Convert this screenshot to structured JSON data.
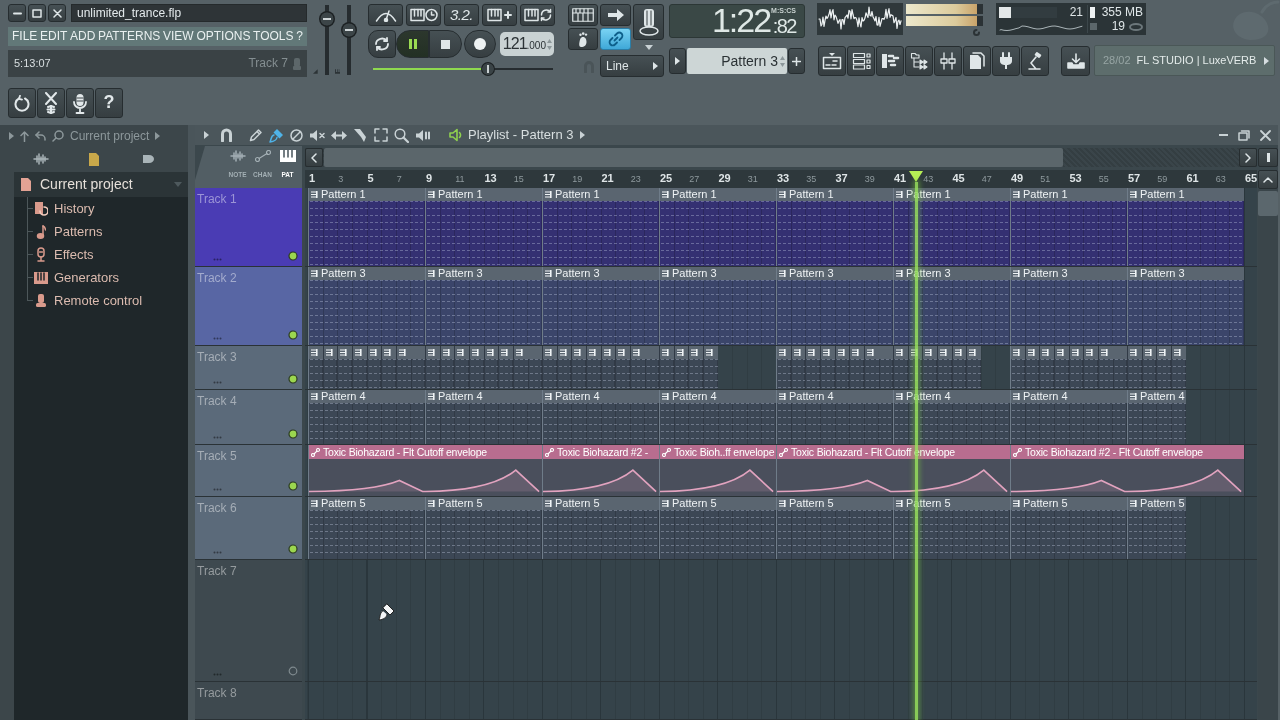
{
  "title_field": "unlimited_trance.flp",
  "menu": [
    "FILE",
    "EDIT",
    "ADD",
    "PATTERNS",
    "VIEW",
    "OPTIONS",
    "TOOLS",
    "?"
  ],
  "hint_bar": {
    "time": "5:13:07",
    "target": "Track 7"
  },
  "master": {
    "volume": {
      "level": 0.88
    },
    "pitch": {
      "level": 0.68
    }
  },
  "transport": {
    "countdown_label": "3.2.",
    "playing": true,
    "tempo": "121",
    "tempo_fraction": ".000",
    "song_position": {
      "level": 0.65
    }
  },
  "snap": {
    "link_on": true,
    "mode": "Line"
  },
  "time_display": {
    "main": "1:22",
    "centiseconds": ":82",
    "format": "M:S:CS"
  },
  "pattern_selector": {
    "value": "Pattern 3"
  },
  "peak_meter": [
    {
      "level": 0.92
    },
    {
      "level": 0.92
    }
  ],
  "cpu_panel": {
    "cpu": {
      "level": 0.2,
      "value": "21"
    },
    "memory": "355 MB",
    "polyphony": "19"
  },
  "hint_panel": {
    "date": "28/02",
    "text": "FL STUDIO | LuxeVERB"
  },
  "quick_buttons": {
    "help": "?"
  },
  "browser": {
    "path": "Current project",
    "tree": [
      {
        "label": "Current project",
        "kind": "project",
        "expanded": true,
        "children": [
          {
            "label": "History",
            "kind": "history"
          },
          {
            "label": "Patterns",
            "kind": "patterns"
          },
          {
            "label": "Effects",
            "kind": "effects"
          },
          {
            "label": "Generators",
            "kind": "generators"
          },
          {
            "label": "Remote control",
            "kind": "remote"
          }
        ]
      }
    ]
  },
  "playlist": {
    "title": "Playlist - Pattern 3",
    "tools": [
      {
        "kind": "pencil",
        "selected": false
      },
      {
        "kind": "brush",
        "selected": true
      },
      {
        "kind": "delete",
        "selected": false
      },
      {
        "kind": "mute",
        "selected": false
      },
      {
        "kind": "slip",
        "selected": false
      },
      {
        "kind": "slice",
        "selected": false
      },
      {
        "kind": "select",
        "selected": false
      },
      {
        "kind": "zoom",
        "selected": false
      },
      {
        "kind": "playback",
        "selected": false
      }
    ],
    "header_tabs": [
      {
        "label": "NOTE",
        "kind": "note",
        "selected": false
      },
      {
        "label": "CHAN",
        "kind": "chan",
        "selected": false
      },
      {
        "label": "PAT",
        "kind": "pat",
        "selected": true
      }
    ],
    "ruler": [
      "1",
      "3",
      "5",
      "7",
      "9",
      "11",
      "13",
      "15",
      "17",
      "19",
      "21",
      "23",
      "25",
      "27",
      "29",
      "31",
      "33",
      "35",
      "37",
      "39",
      "41",
      "43",
      "45",
      "47",
      "49",
      "51",
      "53",
      "55",
      "57",
      "59",
      "61",
      "63",
      "65"
    ],
    "playhead": {
      "level": 0.65
    },
    "tracks": [
      {
        "name": "Track 1",
        "color": "#4a3cb4",
        "active": true,
        "clips": [
          {
            "kind": "pattern",
            "label": "Pattern 1"
          },
          {
            "kind": "pattern",
            "label": "Pattern 1"
          },
          {
            "kind": "pattern",
            "label": "Pattern 1"
          },
          {
            "kind": "pattern",
            "label": "Pattern 1"
          },
          {
            "kind": "pattern",
            "label": "Pattern 1"
          },
          {
            "kind": "pattern",
            "label": "Pattern 1"
          },
          {
            "kind": "pattern",
            "label": "Pattern 1"
          },
          {
            "kind": "pattern",
            "label": "Pattern 1"
          }
        ]
      },
      {
        "name": "Track 2",
        "color": "#5866a4",
        "active": true,
        "clips": [
          {
            "kind": "pattern",
            "label": "Pattern 3"
          },
          {
            "kind": "pattern",
            "label": "Pattern 3"
          },
          {
            "kind": "pattern",
            "label": "Pattern 3"
          },
          {
            "kind": "pattern",
            "label": "Pattern 3"
          },
          {
            "kind": "pattern",
            "label": "Pattern 3"
          },
          {
            "kind": "pattern",
            "label": "Pattern 3"
          },
          {
            "kind": "pattern",
            "label": "Pattern 3"
          },
          {
            "kind": "pattern",
            "label": "Pattern 3"
          }
        ]
      },
      {
        "name": "Track 3",
        "color": "#5b6a7a",
        "active": true,
        "clips": [
          {
            "kind": "pattern"
          },
          {
            "kind": "pattern"
          },
          {
            "kind": "pattern"
          },
          {
            "kind": "pattern"
          },
          {
            "kind": "pattern"
          },
          {
            "kind": "pattern"
          },
          {
            "kind": "pattern"
          },
          {
            "kind": "pattern"
          },
          {
            "kind": "pattern"
          },
          {
            "kind": "pattern"
          },
          {
            "kind": "pattern"
          },
          {
            "kind": "pattern"
          },
          {
            "kind": "pattern"
          },
          {
            "kind": "pattern"
          },
          {
            "kind": "pattern"
          },
          {
            "kind": "pattern"
          },
          {
            "kind": "pattern"
          },
          {
            "kind": "pattern"
          },
          {
            "kind": "pattern"
          },
          {
            "kind": "pattern"
          },
          {
            "kind": "pattern"
          },
          {
            "kind": "pattern"
          },
          {
            "kind": "pattern"
          },
          {
            "kind": "pattern"
          },
          {
            "kind": "pattern"
          },
          {
            "kind": "pattern"
          },
          {
            "kind": "pattern"
          },
          {
            "kind": "pattern"
          },
          {
            "kind": "pattern"
          },
          {
            "kind": "pattern"
          },
          {
            "kind": "pattern"
          },
          {
            "kind": "pattern"
          },
          {
            "kind": "pattern"
          },
          {
            "kind": "pattern"
          },
          {
            "kind": "pattern"
          },
          {
            "kind": "pattern"
          },
          {
            "kind": "pattern"
          },
          {
            "kind": "pattern"
          },
          {
            "kind": "pattern"
          },
          {
            "kind": "pattern"
          },
          {
            "kind": "pattern"
          },
          {
            "kind": "pattern"
          },
          {
            "kind": "pattern"
          },
          {
            "kind": "pattern"
          },
          {
            "kind": "pattern"
          },
          {
            "kind": "pattern"
          },
          {
            "kind": "pattern"
          },
          {
            "kind": "pattern"
          },
          {
            "kind": "pattern"
          }
        ]
      },
      {
        "name": "Track 4",
        "color": "#5b6a7a",
        "active": true,
        "clips": [
          {
            "kind": "pattern",
            "label": "Pattern 4"
          },
          {
            "kind": "pattern",
            "label": "Pattern 4"
          },
          {
            "kind": "pattern",
            "label": "Pattern 4"
          },
          {
            "kind": "pattern",
            "label": "Pattern 4"
          },
          {
            "kind": "pattern",
            "label": "Pattern 4"
          },
          {
            "kind": "pattern",
            "label": "Pattern 4"
          },
          {
            "kind": "pattern",
            "label": "Pattern 4"
          },
          {
            "kind": "pattern",
            "label": "Pattern 4"
          }
        ]
      },
      {
        "name": "Track 5",
        "color": "#5b6a7a",
        "active": true,
        "clips": [
          {
            "kind": "automation",
            "label": "Toxic Biohazard - Flt Cutoff envelope",
            "color": "#b86d8f"
          },
          {
            "kind": "automation",
            "label": "Toxic Biohazard #2 -",
            "color": "#b86d8f"
          },
          {
            "kind": "automation",
            "label": "Toxic Bioh..ff envelope",
            "color": "#b86d8f"
          },
          {
            "kind": "automation",
            "label": "Toxic Biohazard - Flt Cutoff envelope",
            "color": "#b86d8f"
          },
          {
            "kind": "automation",
            "label": "Toxic Biohazard #2 - Flt Cutoff envelope",
            "color": "#b86d8f"
          }
        ]
      },
      {
        "name": "Track 6",
        "color": "#5b6a7a",
        "active": true,
        "clips": [
          {
            "kind": "pattern",
            "label": "Pattern 5"
          },
          {
            "kind": "pattern",
            "label": "Pattern 5"
          },
          {
            "kind": "pattern",
            "label": "Pattern 5"
          },
          {
            "kind": "pattern",
            "label": "Pattern 5"
          },
          {
            "kind": "pattern",
            "label": "Pattern 5"
          },
          {
            "kind": "pattern",
            "label": "Pattern 5"
          },
          {
            "kind": "pattern",
            "label": "Pattern 5"
          },
          {
            "kind": "pattern",
            "label": "Pattern 5"
          }
        ]
      },
      {
        "name": "Track 7",
        "color": "#3e494f",
        "active": false
      },
      {
        "name": "Track 8",
        "color": "#3e494f"
      }
    ]
  }
}
